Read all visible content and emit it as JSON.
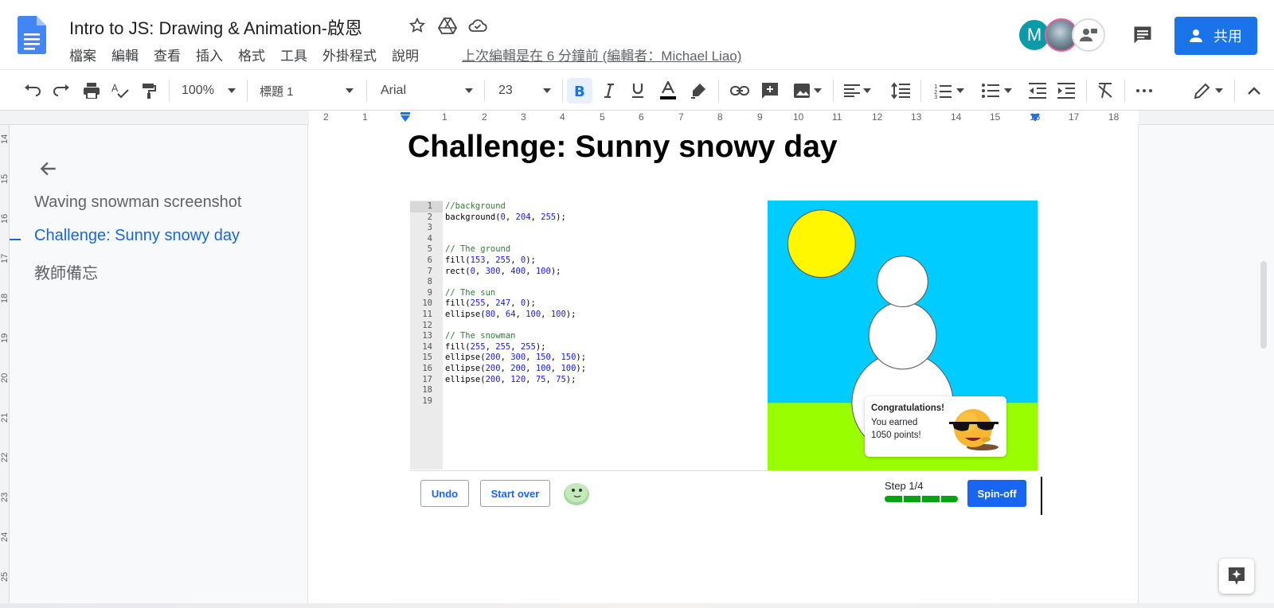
{
  "doc": {
    "title": "Intro to JS: Drawing & Animation-啟恩",
    "last_edit": "上次編輯是在 6 分鐘前 (編輯者：Michael Liao)",
    "share_label": "共用",
    "avatar_initial": "M"
  },
  "menu": [
    "檔案",
    "編輯",
    "查看",
    "插入",
    "格式",
    "工具",
    "外掛程式",
    "說明"
  ],
  "toolbar": {
    "zoom": "100%",
    "style": "標題 1",
    "font": "Arial",
    "font_size": "23"
  },
  "ruler": {
    "marks": [
      "2",
      "1",
      "1",
      "2",
      "3",
      "4",
      "5",
      "6",
      "7",
      "8",
      "9",
      "10",
      "11",
      "12",
      "13",
      "14",
      "15",
      "16",
      "17",
      "18"
    ],
    "left_marks": [
      "14",
      "15",
      "16",
      "17",
      "18",
      "19",
      "20",
      "21",
      "22",
      "23",
      "24",
      "25"
    ]
  },
  "outline": {
    "items": [
      {
        "label": "Waving snowman screenshot",
        "active": false
      },
      {
        "label": "Challenge: Sunny snowy day",
        "active": true
      },
      {
        "label": "教師備忘",
        "active": false
      }
    ]
  },
  "page": {
    "heading": "Challenge: Sunny snowy day"
  },
  "code": {
    "lines": [
      "//background",
      "background(0, 204, 255);",
      "",
      "",
      "// The ground",
      "fill(153, 255, 0);",
      "rect(0, 300, 400, 100);",
      "",
      "// The sun",
      "fill(255, 247, 0);",
      "ellipse(80, 64, 100, 100);",
      "",
      "// The snowman",
      "fill(255, 255, 255);",
      "ellipse(200, 300, 150, 150);",
      "ellipse(200, 200, 100, 100);",
      "ellipse(200, 120, 75, 75);",
      "",
      ""
    ]
  },
  "scene": {
    "sky_color": "#00ccff",
    "ground_color": "#99ff00",
    "sun_color": "#fff700",
    "snow_color": "#ffffff"
  },
  "congrats": {
    "title": "Congratulations!",
    "line1": "You earned",
    "line2": "1050 points!"
  },
  "controls": {
    "undo": "Undo",
    "start_over": "Start over",
    "step": "Step 1/4",
    "spinoff": "Spin-off",
    "progress_segments": 4
  }
}
